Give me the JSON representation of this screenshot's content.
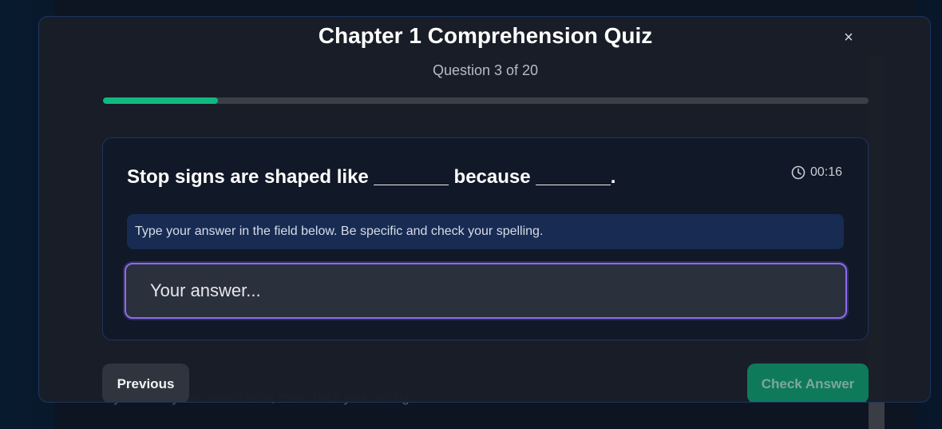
{
  "quiz": {
    "title": "Chapter 1 Comprehension Quiz",
    "close_symbol": "×",
    "subtitle": "Question 3 of 20",
    "progress_fraction": 0.15,
    "accent_color": "#10b981",
    "input_focus_color": "#8b6cf0"
  },
  "question": {
    "text": "Stop signs are shaped like _______ because _______.",
    "timer_icon": "clock-icon",
    "timer": "00:16",
    "instruction": "Type your answer in the field below. Be specific and check your spelling.",
    "answer_value": "",
    "answer_placeholder": "Your answer..."
  },
  "buttons": {
    "previous": "Previous",
    "check_answer": "Check Answer"
  }
}
